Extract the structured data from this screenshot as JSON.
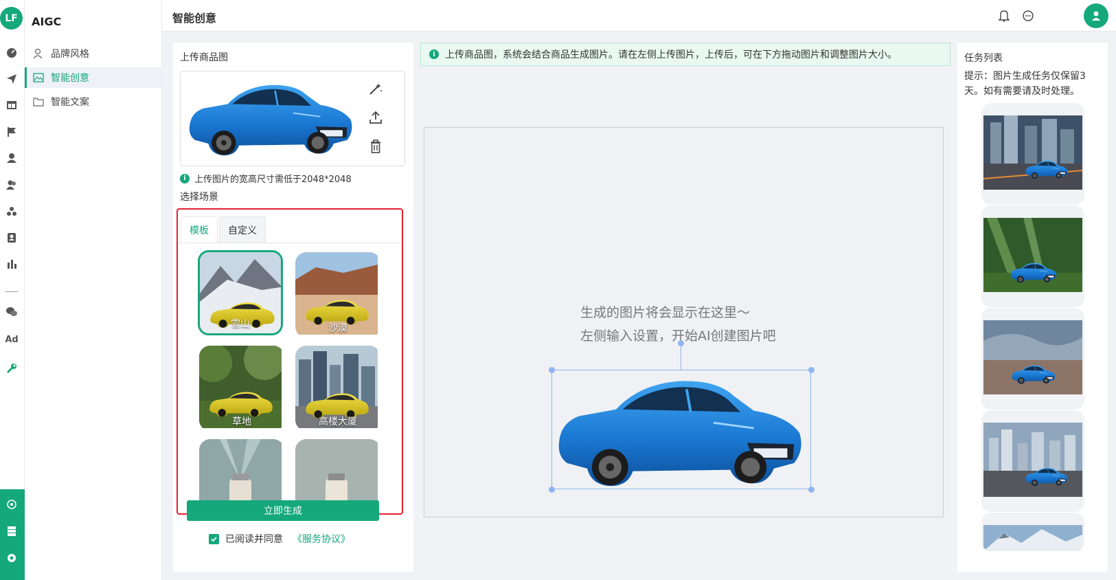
{
  "brand": {
    "logo_text": "LF",
    "app_name": "AIGC"
  },
  "rail": {
    "icons": [
      "dashboard-icon",
      "send-icon",
      "layout-icon",
      "flag-icon",
      "user-icon",
      "users-icon",
      "group-icon",
      "contact-icon",
      "bar-chart-icon",
      "divider",
      "wechat-icon",
      "ad-icon",
      "wrench-icon"
    ],
    "ad_text": "Ad",
    "bottom_icons": [
      "ai-icon",
      "server-icon",
      "settings-icon"
    ]
  },
  "menu": {
    "items": [
      {
        "label": "品牌风格",
        "icon": "brand-style-icon",
        "active": false
      },
      {
        "label": "智能创意",
        "icon": "image-icon",
        "active": true
      },
      {
        "label": "智能文案",
        "icon": "folder-icon",
        "active": false
      }
    ]
  },
  "header": {
    "title": "智能创意",
    "icons": [
      "bell-icon",
      "message-icon",
      "avatar-icon"
    ]
  },
  "left_panel": {
    "upload_label": "上传商品图",
    "tools": [
      "magic-wand-icon",
      "upload-icon",
      "trash-icon"
    ],
    "size_hint": "上传图片的宽高尺寸需低于2048*2048",
    "scene_label": "选择场景",
    "tabs": [
      {
        "label": "模板",
        "active": true
      },
      {
        "label": "自定义",
        "active": false
      }
    ],
    "templates": [
      {
        "label": "雪山",
        "selected": true
      },
      {
        "label": "沙漠",
        "selected": false
      },
      {
        "label": "草地",
        "selected": false
      },
      {
        "label": "高楼大厦",
        "selected": false
      },
      {
        "label": "",
        "selected": false
      },
      {
        "label": "",
        "selected": false
      }
    ],
    "generate_button": "立即生成",
    "agree_text": "已阅读并同意",
    "agree_link": "《服务协议》",
    "agree_checked": true,
    "plate_text": "ﾖｾｿﾇｸA"
  },
  "center": {
    "notice": "上传商品图，系统会结合商品生成图片。请在左侧上传图片，上传后，可在下方拖动图片和调整图片大小。",
    "placeholder_line1": "生成的图片将会显示在这里～",
    "placeholder_line2": "左侧输入设置，开始AI创建图片吧"
  },
  "right_panel": {
    "title": "任务列表",
    "tip": "提示：图片生成任务仅保留3天。如有需要请及时处理。",
    "thumbnails": [
      "city-night",
      "forest-sunbeams",
      "desert-dusk",
      "city-skyline",
      "snow-mountain"
    ]
  },
  "colors": {
    "accent": "#14a87b",
    "highlight_border": "#e3202f",
    "car_blue": "#1f7fd6",
    "selection_blue": "#8fb4f0"
  }
}
